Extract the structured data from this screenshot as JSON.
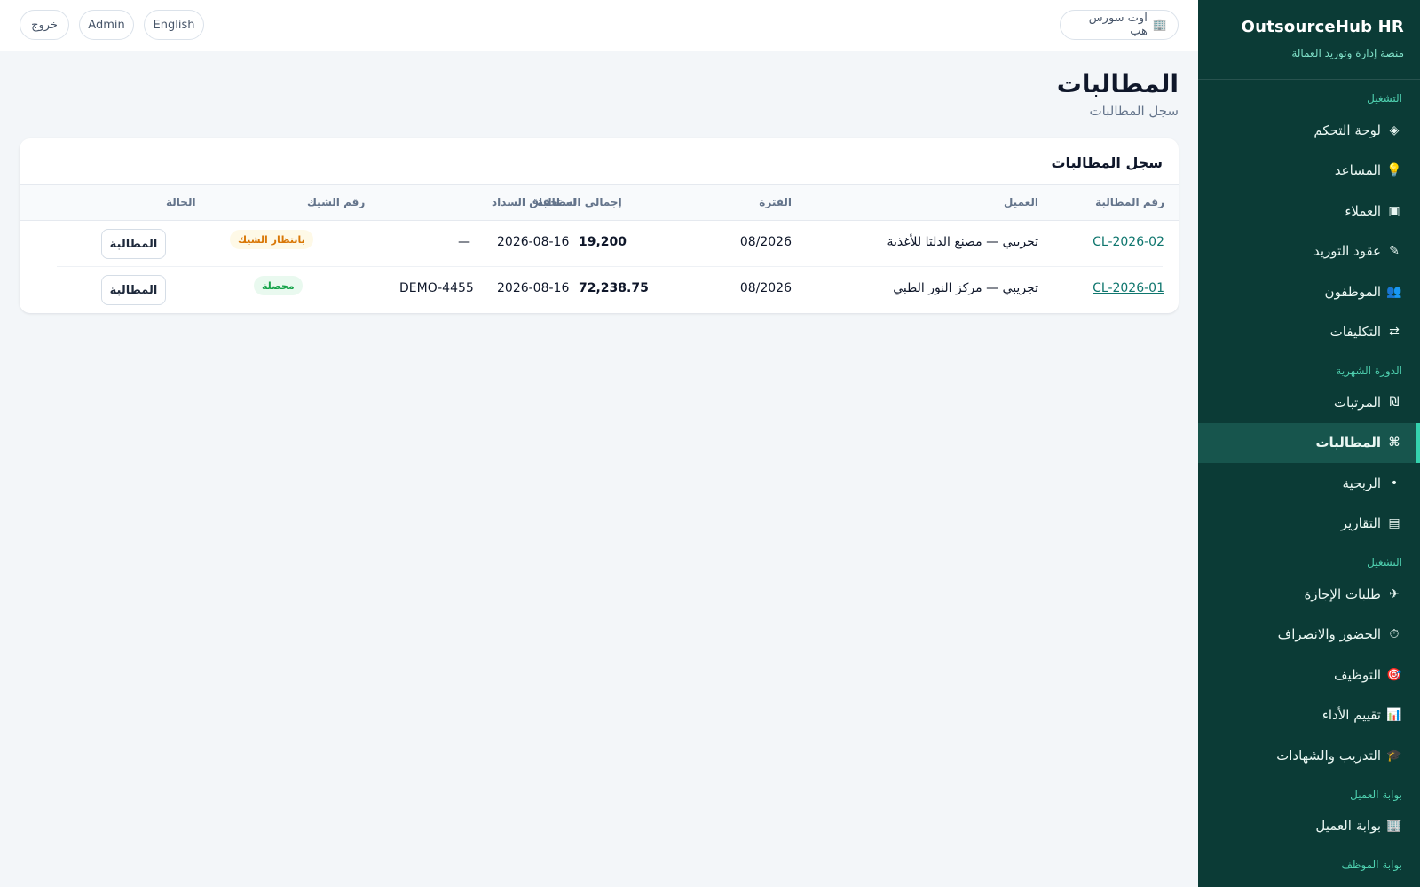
{
  "sidebar": {
    "brand_title": "OutsourceHub HR",
    "brand_subtitle": "منصة إدارة وتوريد العمالة",
    "sections": [
      {
        "label": "التشغيل"
      },
      {
        "label": "الدورة الشهرية"
      },
      {
        "label": "التشغيل"
      },
      {
        "label": "بوابة العميل"
      },
      {
        "label": "بوابة الموظف"
      }
    ],
    "items": [
      {
        "icon": "◈",
        "label": "لوحة التحكم"
      },
      {
        "icon": "💡",
        "label": "المساعد"
      },
      {
        "icon": "▣",
        "label": "العملاء"
      },
      {
        "icon": "✎",
        "label": "عقود التوريد"
      },
      {
        "icon": "👥",
        "label": "الموظفون"
      },
      {
        "icon": "⇄",
        "label": "التكليفات"
      },
      {
        "icon": "₪",
        "label": "المرتبات"
      },
      {
        "icon": "⌘",
        "label": "المطالبات"
      },
      {
        "icon": "•",
        "label": "الربحية"
      },
      {
        "icon": "▤",
        "label": "التقارير"
      },
      {
        "icon": "✈",
        "label": "طلبات الإجازة"
      },
      {
        "icon": "⏱",
        "label": "الحضور والانصراف"
      },
      {
        "icon": "🎯",
        "label": "التوظيف"
      },
      {
        "icon": "📊",
        "label": "تقييم الأداء"
      },
      {
        "icon": "🎓",
        "label": "التدريب والشهادات"
      },
      {
        "icon": "🏢",
        "label": "بوابة العميل"
      }
    ]
  },
  "topbar": {
    "company_icon": "🏢",
    "company_label": "اوت سورس هب",
    "lang_label": "English",
    "user_label": "Admin",
    "logout_label": "خروج"
  },
  "page": {
    "title": "المطالبات",
    "subtitle": "سجل المطالبات"
  },
  "card": {
    "title": "سجل المطالبات",
    "columns": [
      "رقم المطالبة",
      "العميل",
      "الفترة",
      "إجمالي المطالبة",
      "استحقاق السداد",
      "رقم الشيك",
      "الحالة"
    ],
    "rows": [
      {
        "claim_no": "CL-2026-02",
        "client": "تجريبي — مصنع الدلتا للأغذية",
        "period": "08/2026",
        "total": "19,200",
        "due": "2026-08-16",
        "cheque": "—",
        "status": "بانتظار الشيك",
        "action": "المطالبة"
      },
      {
        "claim_no": "CL-2026-01",
        "client": "تجريبي — مركز النور الطبي",
        "period": "08/2026",
        "total": "72,238.75",
        "due": "2026-08-16",
        "cheque": "DEMO-4455",
        "status": "محصلة",
        "action": "المطالبة"
      }
    ]
  },
  "colors": {
    "sidebar_bg": "#0b3b36",
    "accent": "#34d2ae",
    "link": "#0f766e",
    "pending": "#d97706",
    "paid": "#16a34a"
  }
}
